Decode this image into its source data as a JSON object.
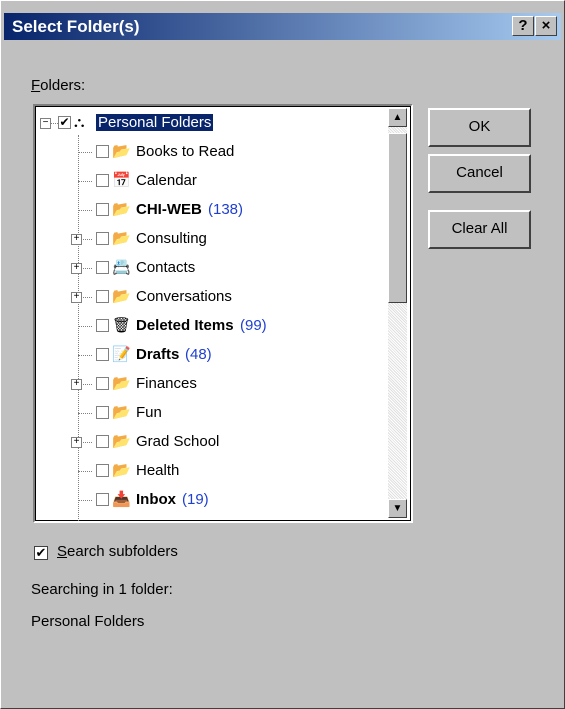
{
  "window": {
    "title": "Select Folder(s)",
    "help_glyph": "?",
    "close_glyph": "×"
  },
  "folders_label": "Folders:",
  "folders_label_hotkey": "F",
  "folders_label_rest": "olders:",
  "tree": {
    "items": [
      {
        "name": "Personal Folders",
        "icon": "personal-folders-icon",
        "checked": true,
        "bold": false,
        "count": "",
        "expandable": true,
        "expanded": true,
        "selected": true,
        "glyph": "⛬"
      },
      {
        "name": "Books to Read",
        "icon": "folder-icon",
        "checked": false,
        "bold": false,
        "count": "",
        "expandable": false,
        "glyph": "📂"
      },
      {
        "name": "Calendar",
        "icon": "calendar-icon",
        "checked": false,
        "bold": false,
        "count": "",
        "expandable": false,
        "glyph": "📅"
      },
      {
        "name": "CHI-WEB",
        "icon": "folder-icon",
        "checked": false,
        "bold": true,
        "count": "(138)",
        "expandable": false,
        "glyph": "📂"
      },
      {
        "name": "Consulting",
        "icon": "folder-icon",
        "checked": false,
        "bold": false,
        "count": "",
        "expandable": true,
        "glyph": "📂"
      },
      {
        "name": "Contacts",
        "icon": "contacts-icon",
        "checked": false,
        "bold": false,
        "count": "",
        "expandable": true,
        "glyph": "📇"
      },
      {
        "name": "Conversations",
        "icon": "folder-icon",
        "checked": false,
        "bold": false,
        "count": "",
        "expandable": true,
        "glyph": "📂"
      },
      {
        "name": "Deleted Items",
        "icon": "trash-icon",
        "checked": false,
        "bold": true,
        "count": "(99)",
        "expandable": false,
        "glyph": "🗑"
      },
      {
        "name": "Drafts",
        "icon": "drafts-icon",
        "checked": false,
        "bold": true,
        "count": "(48)",
        "expandable": false,
        "glyph": "📝"
      },
      {
        "name": "Finances",
        "icon": "folder-icon",
        "checked": false,
        "bold": false,
        "count": "",
        "expandable": true,
        "glyph": "📂"
      },
      {
        "name": "Fun",
        "icon": "folder-icon",
        "checked": false,
        "bold": false,
        "count": "",
        "expandable": false,
        "glyph": "📂"
      },
      {
        "name": "Grad School",
        "icon": "folder-icon",
        "checked": false,
        "bold": false,
        "count": "",
        "expandable": true,
        "glyph": "📂"
      },
      {
        "name": "Health",
        "icon": "folder-icon",
        "checked": false,
        "bold": false,
        "count": "",
        "expandable": false,
        "glyph": "📂"
      },
      {
        "name": "Inbox",
        "icon": "inbox-icon",
        "checked": false,
        "bold": true,
        "count": "(19)",
        "expandable": false,
        "glyph": "📥"
      }
    ]
  },
  "buttons": {
    "ok": "OK",
    "cancel": "Cancel",
    "clear_all": "Clear All"
  },
  "search_subfolders": {
    "label": "Search subfolders",
    "hotkey": "S",
    "rest": "earch subfolders",
    "checked": true
  },
  "status": {
    "searching": "Searching in 1 folder:",
    "folder": "Personal Folders"
  },
  "colors": {
    "title_gradient_start": "#08246b",
    "title_gradient_end": "#a6caf0",
    "count_blue": "#1f3fd1",
    "dialog_gray": "#c0c0c0"
  }
}
